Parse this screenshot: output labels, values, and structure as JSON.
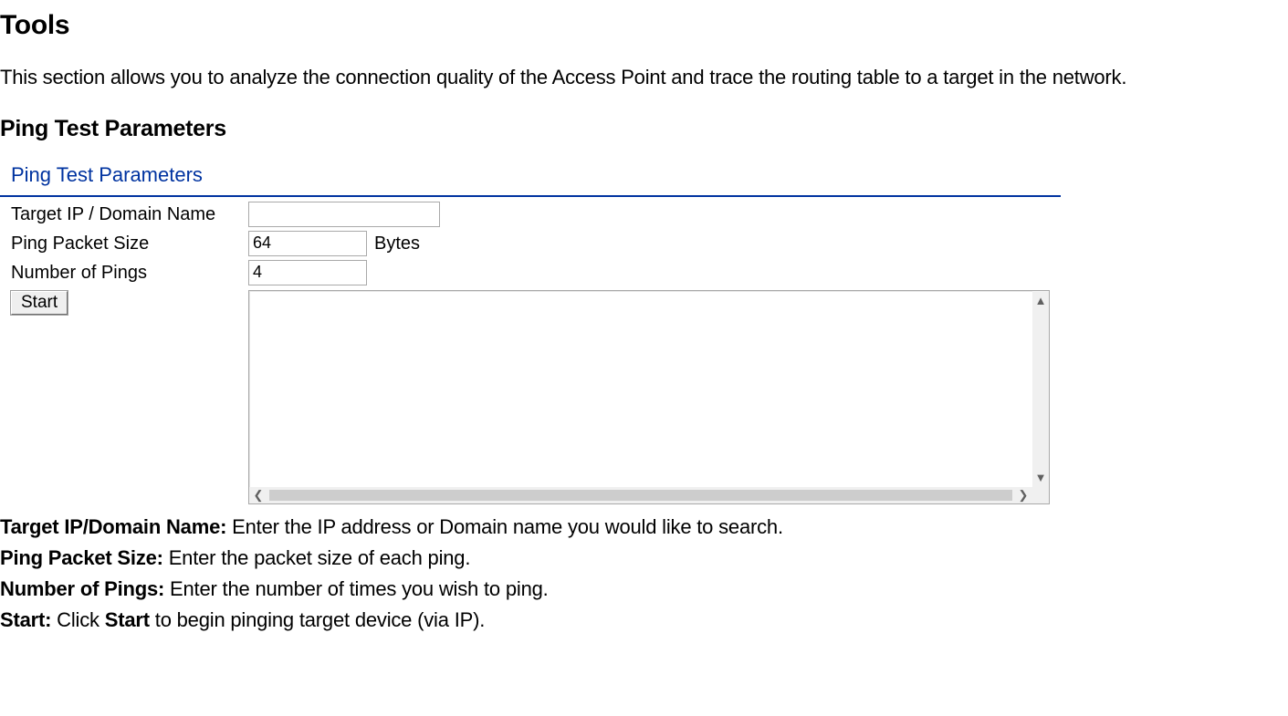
{
  "heading": "Tools",
  "description": "This section allows you to analyze the connection quality of the Access Point and trace the routing table to a target in the network.",
  "subheading": "Ping Test Parameters",
  "panel": {
    "title": "Ping Test Parameters",
    "fields": {
      "target_label": "Target IP / Domain Name",
      "target_value": "",
      "packet_label": "Ping Packet Size",
      "packet_value": "64",
      "packet_unit": "Bytes",
      "pings_label": "Number of Pings",
      "pings_value": "4"
    },
    "start_label": "Start",
    "output_value": ""
  },
  "definitions": [
    {
      "term": "Target IP/Domain Name:",
      "desc": " Enter the IP address or Domain name you would like to search."
    },
    {
      "term": "Ping Packet Size:",
      "desc": " Enter the packet size of each ping."
    },
    {
      "term": "Number of Pings:",
      "desc": " Enter the number of times you wish to ping."
    },
    {
      "term": "Start:",
      "desc_pre": " Click ",
      "bold_mid": "Start",
      "desc_post": " to begin pinging target device (via IP)."
    }
  ]
}
